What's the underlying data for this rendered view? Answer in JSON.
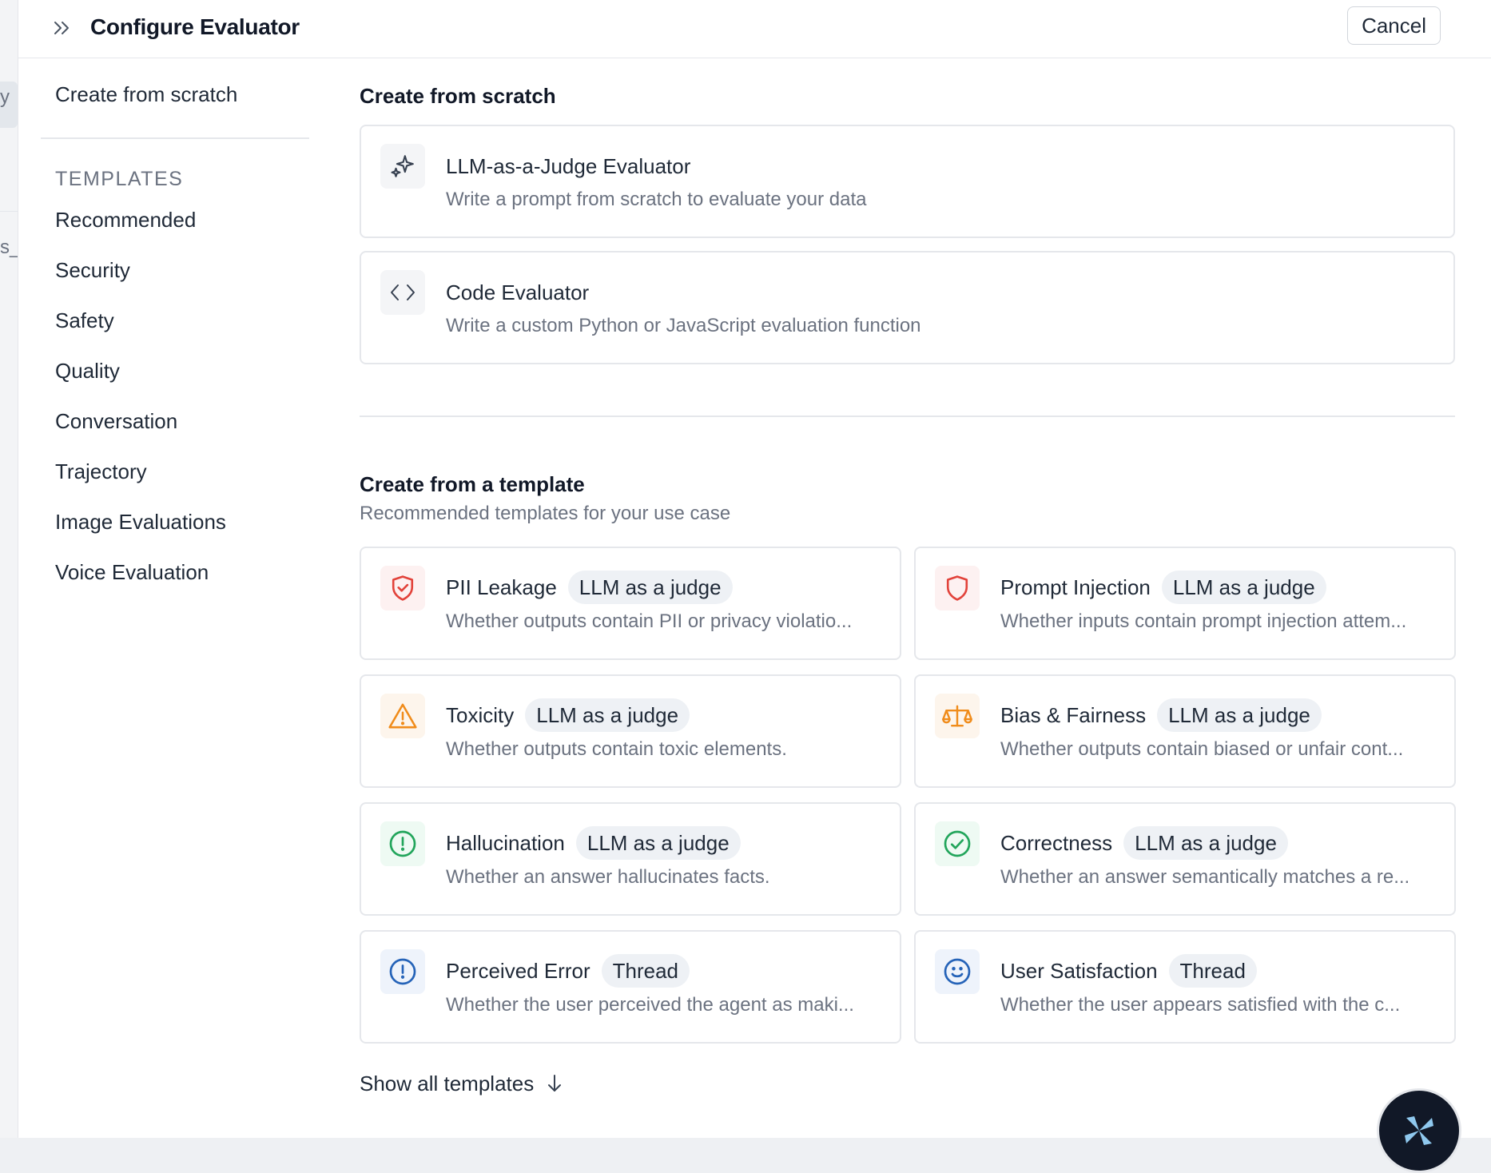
{
  "background": {
    "fragment_top": "y",
    "fragment_mid": "s_"
  },
  "header": {
    "title": "Configure Evaluator",
    "cancel_label": "Cancel"
  },
  "nav": {
    "create_from_scratch": "Create from scratch",
    "templates_heading": "TEMPLATES",
    "items": [
      "Recommended",
      "Security",
      "Safety",
      "Quality",
      "Conversation",
      "Trajectory",
      "Image Evaluations",
      "Voice Evaluation"
    ]
  },
  "scratch": {
    "title": "Create from scratch",
    "cards": [
      {
        "title": "LLM-as-a-Judge Evaluator",
        "desc": "Write a prompt from scratch to evaluate your data",
        "icon": "sparkles-icon"
      },
      {
        "title": "Code Evaluator",
        "desc": "Write a custom Python or JavaScript evaluation function",
        "icon": "code-icon"
      }
    ]
  },
  "templates": {
    "title": "Create from a template",
    "subtitle": "Recommended templates for your use case",
    "cards": [
      {
        "title": "PII Leakage",
        "badge": "LLM as a judge",
        "desc": "Whether outputs contain PII or privacy violatio...",
        "icon": "shield-check-icon",
        "color": "#e2433b"
      },
      {
        "title": "Prompt Injection",
        "badge": "LLM as a judge",
        "desc": "Whether inputs contain prompt injection attem...",
        "icon": "shield-icon",
        "color": "#e2433b"
      },
      {
        "title": "Toxicity",
        "badge": "LLM as a judge",
        "desc": "Whether outputs contain toxic elements.",
        "icon": "warning-icon",
        "color": "#f08c1b"
      },
      {
        "title": "Bias & Fairness",
        "badge": "LLM as a judge",
        "desc": "Whether outputs contain biased or unfair cont...",
        "icon": "scale-icon",
        "color": "#f08c1b"
      },
      {
        "title": "Hallucination",
        "badge": "LLM as a judge",
        "desc": "Whether an answer hallucinates facts.",
        "icon": "alert-circle-icon",
        "color": "#22a55b"
      },
      {
        "title": "Correctness",
        "badge": "LLM as a judge",
        "desc": "Whether an answer semantically matches a re...",
        "icon": "check-circle-icon",
        "color": "#22a55b"
      },
      {
        "title": "Perceived Error",
        "badge": "Thread",
        "desc": "Whether the user perceived the agent as maki...",
        "icon": "alert-circle-icon",
        "color": "#2563b8"
      },
      {
        "title": "User Satisfaction",
        "badge": "Thread",
        "desc": "Whether the user appears satisfied with the c...",
        "icon": "smile-icon",
        "color": "#2563b8"
      }
    ],
    "show_all_label": "Show all templates"
  }
}
